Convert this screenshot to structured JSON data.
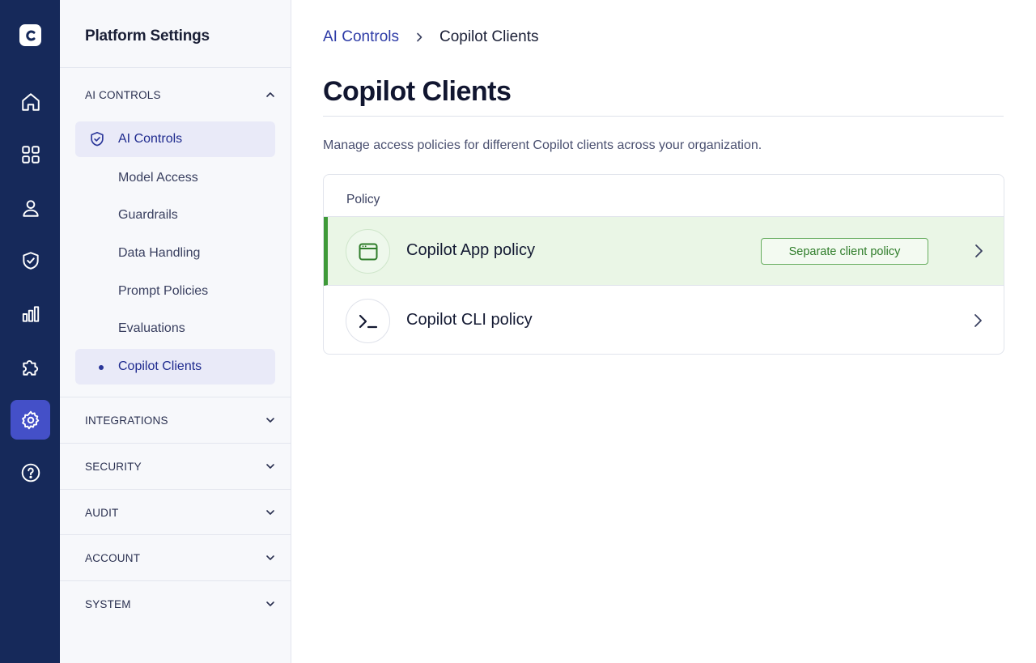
{
  "sidebar": {
    "title": "Platform Settings",
    "sections": [
      {
        "label": "AI CONTROLS",
        "expanded": true
      },
      {
        "label": "INTEGRATIONS",
        "expanded": false
      },
      {
        "label": "SECURITY",
        "expanded": false
      },
      {
        "label": "AUDIT",
        "expanded": false
      },
      {
        "label": "ACCOUNT",
        "expanded": false
      },
      {
        "label": "SYSTEM",
        "expanded": false
      }
    ],
    "items": [
      {
        "label": "AI Controls",
        "icon": "shield-check-icon"
      },
      {
        "label": "Model Access"
      },
      {
        "label": "Guardrails"
      },
      {
        "label": "Data Handling"
      },
      {
        "label": "Prompt Policies"
      },
      {
        "label": "Evaluations"
      },
      {
        "label": "Copilot Clients",
        "selected": true
      }
    ]
  },
  "rail": {
    "icons": [
      "home-icon",
      "grid-icon",
      "user-icon",
      "shield-icon",
      "bar-chart-icon",
      "puzzle-icon",
      "gear-icon",
      "help-icon"
    ],
    "active": "gear-icon"
  },
  "breadcrumb": {
    "parent": "AI Controls",
    "current": "Copilot Clients"
  },
  "main": {
    "title": "Copilot Clients",
    "description": "Manage access policies for different Copilot clients across your organization."
  },
  "policy_table": {
    "header": "Policy",
    "rows": [
      {
        "name": "Copilot App policy",
        "icon": "app-window-icon",
        "badge": "Separate client policy",
        "selected": true
      },
      {
        "name": "Copilot CLI policy",
        "icon": "terminal-icon",
        "selected": false
      }
    ]
  },
  "colors": {
    "rail_bg": "#16295a",
    "rail_active": "#4450c8",
    "accent": "#2c3aa6",
    "selected_row_bg": "#eaf6e6",
    "selected_row_bar": "#3e9a38"
  }
}
